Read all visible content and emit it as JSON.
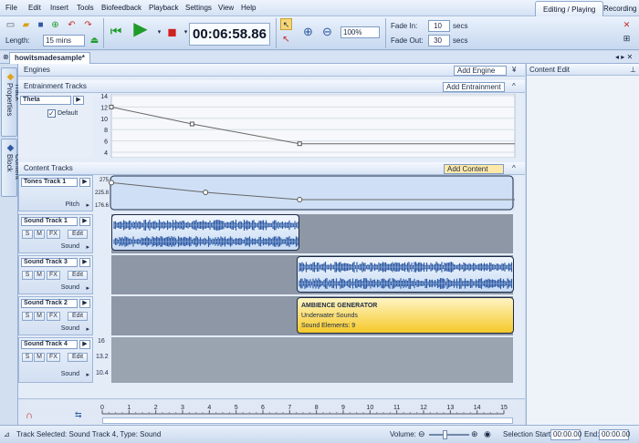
{
  "menu": [
    "File",
    "Edit",
    "Insert",
    "Tools",
    "Biofeedback",
    "Playback",
    "Settings",
    "View",
    "Help"
  ],
  "mode_tabs": [
    "Editing / Playing",
    "Recording"
  ],
  "toolbar": {
    "length_label": "Length:",
    "length_value": "15 mins",
    "timer": "00:06:58.86",
    "zoom_value": "100%",
    "fade_in_label": "Fade In:",
    "fade_in_value": "10",
    "fade_out_label": "Fade Out:",
    "fade_out_value": "30",
    "secs": "secs"
  },
  "document_tab": "howitsmadesample*",
  "sidebar": {
    "track_properties": "Track Properties",
    "content_block": "Content Block"
  },
  "engines": {
    "title": "Engines",
    "button": "Add Engine"
  },
  "entrainment": {
    "title": "Entrainment Tracks",
    "button": "Add Entrainment",
    "track_name": "Theta",
    "default_label": "Default",
    "ticks": [
      "14",
      "12",
      "10",
      "8",
      "6",
      "4"
    ],
    "curve": [
      {
        "t": 0,
        "v": 12
      },
      {
        "t": 3,
        "v": 9
      },
      {
        "t": 7,
        "v": 5.5
      },
      {
        "t": 15,
        "v": 5.5
      }
    ]
  },
  "content": {
    "title": "Content Tracks",
    "button": "Add Content",
    "tones": {
      "name": "Tones Track 1",
      "param": "Pitch",
      "ticks": [
        "275",
        "225.8",
        "176.6"
      ],
      "curve": [
        {
          "t": 0,
          "v": 260
        },
        {
          "t": 3.5,
          "v": 220
        },
        {
          "t": 7,
          "v": 190
        },
        {
          "t": 15,
          "v": 190
        }
      ]
    },
    "tracks": [
      {
        "name": "Sound Track 1",
        "param": "Sound"
      },
      {
        "name": "Sound Track 3",
        "param": "Sound"
      },
      {
        "name": "Sound Track 2",
        "param": "Sound"
      },
      {
        "name": "Sound Track 4",
        "param": "Sound"
      }
    ],
    "buttons": {
      "s": "S",
      "m": "M",
      "fx": "FX",
      "edit": "Edit"
    },
    "track4_ticks": [
      "16",
      "13.2",
      "10.4"
    ],
    "ambience": {
      "title": "AMBIENCE GENERATOR",
      "line1": "Underwater Sounds",
      "line2": "Sound Elements: 9"
    }
  },
  "ruler": [
    "0",
    "1",
    "2",
    "3",
    "4",
    "5",
    "6",
    "7",
    "8",
    "9",
    "10",
    "11",
    "12",
    "13",
    "14",
    "15"
  ],
  "right_panel": {
    "title": "Content Edit"
  },
  "status": {
    "text": "Track Selected: Sound Track 4, Type: Sound",
    "volume_label": "Volume:",
    "selection_start_label": "Selection Start:",
    "selection_start": "00:00.00",
    "end_label": "End:",
    "end": "00:00.00"
  },
  "colors": {
    "clip_border": "#1b2a45",
    "wave": "#2e5aa3",
    "ambience": "#f7cf2a"
  },
  "icons": [
    "new-icon",
    "open-icon",
    "save-icon",
    "add-icon",
    "undo-icon",
    "redo-icon",
    "export-icon",
    "rewind-icon",
    "play-icon",
    "stop-icon",
    "pointer-icon",
    "zoom-in-icon",
    "zoom-out-icon",
    "magnet-icon"
  ]
}
